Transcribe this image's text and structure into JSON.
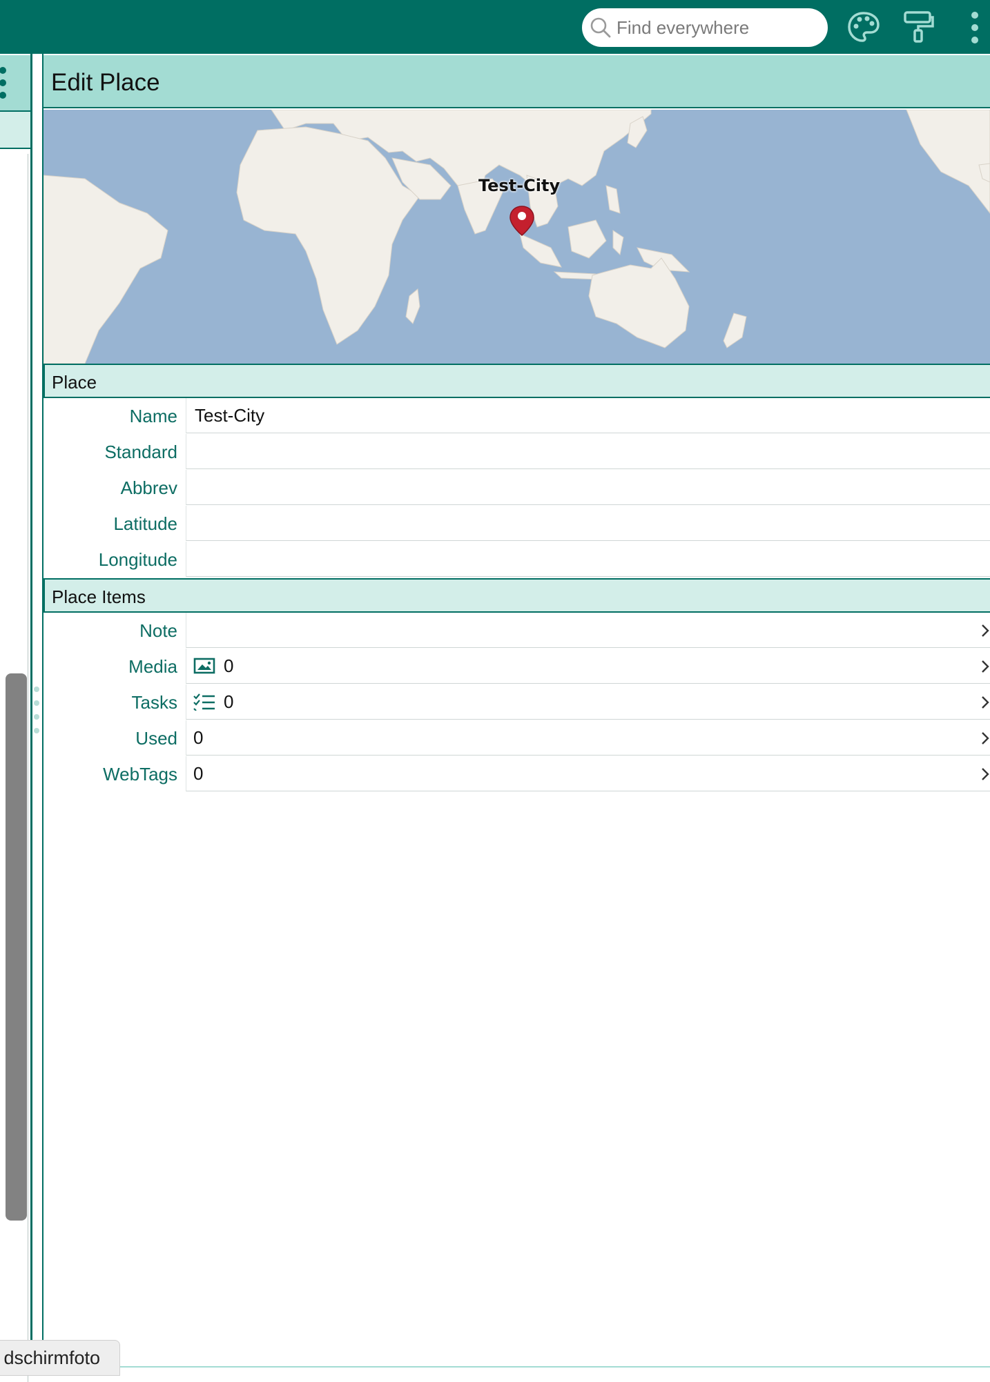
{
  "topbar": {
    "search": {
      "placeholder": "Find everywhere",
      "value": ""
    },
    "icons": [
      "search-icon",
      "palette-icon",
      "paint-roller-icon",
      "more-vertical-icon"
    ]
  },
  "editor": {
    "title": "Edit Place",
    "map": {
      "marker_label": "Test-City",
      "marker_color": "#c4202e"
    },
    "place_section": {
      "title": "Place",
      "fields": [
        {
          "label": "Name",
          "value": "Test-City"
        },
        {
          "label": "Standard",
          "value": ""
        },
        {
          "label": "Abbrev",
          "value": ""
        },
        {
          "label": "Latitude",
          "value": ""
        },
        {
          "label": "Longitude",
          "value": ""
        }
      ]
    },
    "items_section": {
      "title": "Place Items",
      "rows": [
        {
          "label": "Note",
          "value": "",
          "icon": ""
        },
        {
          "label": "Media",
          "value": "0",
          "icon": "image-icon"
        },
        {
          "label": "Tasks",
          "value": "0",
          "icon": "checklist-icon"
        },
        {
          "label": "Used",
          "value": "0",
          "icon": ""
        },
        {
          "label": "WebTags",
          "value": "0",
          "icon": ""
        }
      ]
    }
  },
  "bottom_tab": {
    "label": "dschirmfoto"
  },
  "colors": {
    "brand": "#006e62",
    "header": "#a3dcd3",
    "section": "#d3eee9",
    "label": "#0d6d63",
    "ocean": "#98b4d2",
    "land": "#f2efe9"
  }
}
